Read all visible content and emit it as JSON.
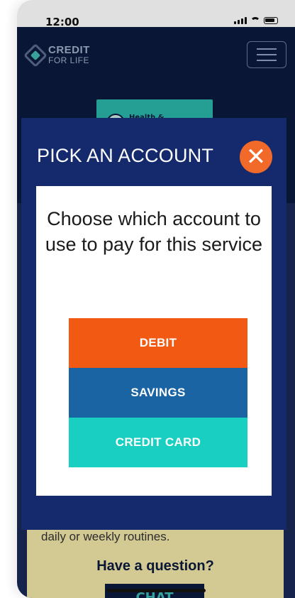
{
  "status_bar": {
    "time": "12:00"
  },
  "header": {
    "logo_line1": "CREDIT",
    "logo_line2": "FOR LIFE",
    "chip_label": "Health &"
  },
  "background_card": {
    "partial_text": "daily or weekly routines.",
    "question": "Have a question?",
    "chat_label": "CHAT"
  },
  "modal": {
    "title": "PICK AN ACCOUNT",
    "close_icon": "close-icon",
    "prompt": "Choose which account to use to pay for this service",
    "options": [
      {
        "label": "DEBIT",
        "color": "#f25a14"
      },
      {
        "label": "SAVINGS",
        "color": "#1a64a3"
      },
      {
        "label": "CREDIT CARD",
        "color": "#18cfc2"
      }
    ]
  },
  "colors": {
    "navy": "#0c1a3e",
    "modal_blue": "#142a6c",
    "close_orange": "#f26a2a"
  }
}
